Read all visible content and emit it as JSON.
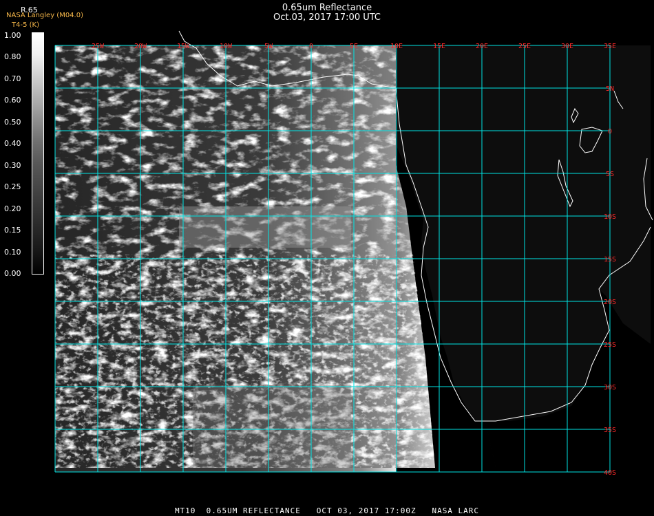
{
  "title": {
    "line1": "0.65um Reflectance",
    "line2": "Oct.03, 2017 17:00 UTC"
  },
  "credit": {
    "line1": "NASA Langley (M04.0)",
    "line2": "T4-5 (K)"
  },
  "colorbar": {
    "label": "R.65",
    "ticks": [
      "1.00",
      "0.80",
      "0.70",
      "0.60",
      "0.50",
      "0.40",
      "0.30",
      "0.25",
      "0.20",
      "0.15",
      "0.10",
      "0.00"
    ]
  },
  "map": {
    "lon_labels": [
      "25W",
      "20W",
      "15W",
      "10W",
      "5W",
      "0",
      "5E",
      "10E",
      "15E",
      "20E",
      "25E",
      "30E",
      "35E"
    ],
    "lat_labels": [
      "5N",
      "0",
      "5S",
      "10S",
      "15S",
      "20S",
      "25S",
      "30S",
      "35S",
      "40S"
    ],
    "colors": {
      "grid": "#00e5e5",
      "label": "#ff2a2a",
      "background": "#000000",
      "land": "#0d0d0d",
      "coastline": "#ffffff"
    }
  },
  "footer": "MT10  0.65UM REFLECTANCE   OCT 03, 2017 17:00Z   NASA LARC"
}
